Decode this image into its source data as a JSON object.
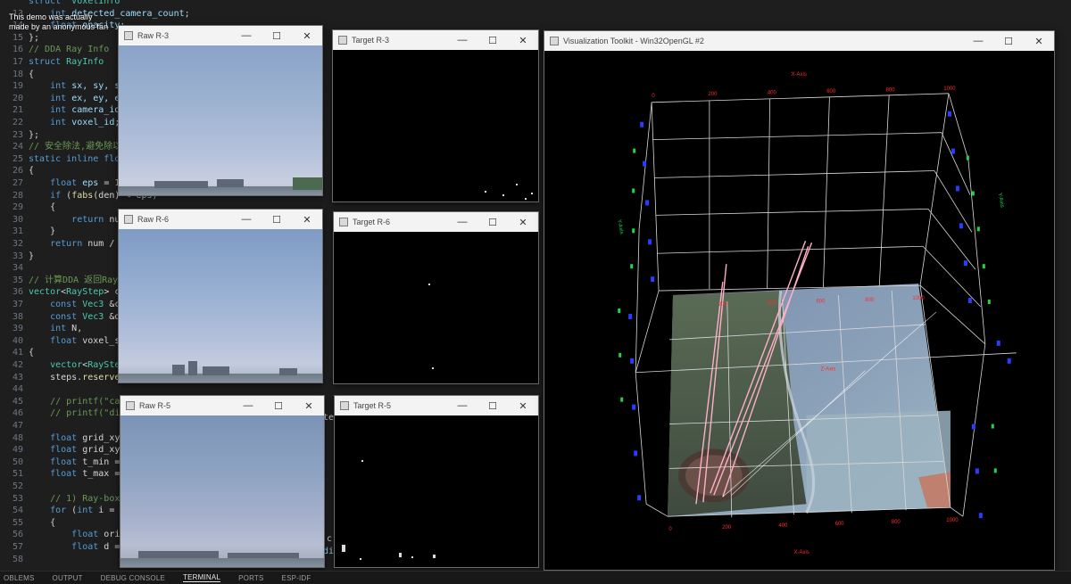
{
  "overlay": {
    "line1": "This demo was actually",
    "line2": "made by an anonymous fan"
  },
  "editor": {
    "lines": [
      {
        "num": "",
        "parts": [
          [
            "kw",
            "struct"
          ],
          [
            "",
            "  "
          ],
          [
            "ty",
            "VoxelInfo"
          ]
        ]
      },
      {
        "num": "13",
        "parts": [
          [
            "",
            "    "
          ],
          [
            "kw",
            "int"
          ],
          [
            "",
            " "
          ],
          [
            "vr",
            "detected_camera_count"
          ],
          [
            "",
            ";"
          ]
        ]
      },
      {
        "num": "14",
        "parts": [
          [
            "",
            "    "
          ],
          [
            "kw",
            "float"
          ],
          [
            "",
            " "
          ],
          [
            "vr",
            "opacity"
          ],
          [
            "",
            ";"
          ]
        ]
      },
      {
        "num": "15",
        "parts": [
          [
            "",
            "};"
          ]
        ]
      },
      {
        "num": "16",
        "parts": [
          [
            "cm",
            "// DDA Ray Info"
          ]
        ]
      },
      {
        "num": "17",
        "parts": [
          [
            "kw",
            "struct"
          ],
          [
            "",
            " "
          ],
          [
            "ty",
            "RayInfo"
          ]
        ]
      },
      {
        "num": "18",
        "parts": [
          [
            "",
            "{"
          ]
        ]
      },
      {
        "num": "19",
        "parts": [
          [
            "",
            "    "
          ],
          [
            "kw",
            "int"
          ],
          [
            "",
            " "
          ],
          [
            "vr",
            "sx, sy, sz"
          ],
          [
            "",
            ";"
          ]
        ]
      },
      {
        "num": "20",
        "parts": [
          [
            "",
            "    "
          ],
          [
            "kw",
            "int"
          ],
          [
            "",
            " "
          ],
          [
            "vr",
            "ex, ey, ez"
          ],
          [
            "",
            ";"
          ]
        ]
      },
      {
        "num": "21",
        "parts": [
          [
            "",
            "    "
          ],
          [
            "kw",
            "int"
          ],
          [
            "",
            " "
          ],
          [
            "vr",
            "camera_id"
          ],
          [
            "",
            ";"
          ]
        ]
      },
      {
        "num": "22",
        "parts": [
          [
            "",
            "    "
          ],
          [
            "kw",
            "int"
          ],
          [
            "",
            " "
          ],
          [
            "vr",
            "voxel_id"
          ],
          [
            "",
            ";"
          ]
        ]
      },
      {
        "num": "23",
        "parts": [
          [
            "",
            "};"
          ]
        ]
      },
      {
        "num": "24",
        "parts": [
          [
            "cm",
            "// 安全除法,避免除以"
          ]
        ]
      },
      {
        "num": "25",
        "parts": [
          [
            "kw",
            "static inline float"
          ]
        ]
      },
      {
        "num": "26",
        "parts": [
          [
            "",
            "{"
          ]
        ]
      },
      {
        "num": "27",
        "parts": [
          [
            "",
            "    "
          ],
          [
            "kw",
            "float"
          ],
          [
            "",
            " "
          ],
          [
            "vr",
            "eps"
          ],
          [
            "",
            " = "
          ],
          [
            "nm",
            "1e"
          ]
        ]
      },
      {
        "num": "28",
        "parts": [
          [
            "",
            "    "
          ],
          [
            "kw",
            "if"
          ],
          [
            "",
            " ("
          ],
          [
            "fn",
            "fabs"
          ],
          [
            "",
            "(den) < eps)"
          ]
        ]
      },
      {
        "num": "29",
        "parts": [
          [
            "",
            "    {"
          ]
        ]
      },
      {
        "num": "30",
        "parts": [
          [
            "",
            "        "
          ],
          [
            "kw",
            "return"
          ],
          [
            "",
            " num"
          ]
        ]
      },
      {
        "num": "31",
        "parts": [
          [
            "",
            "    }"
          ]
        ]
      },
      {
        "num": "32",
        "parts": [
          [
            "",
            "    "
          ],
          [
            "kw",
            "return"
          ],
          [
            "",
            " num / d"
          ]
        ]
      },
      {
        "num": "33",
        "parts": [
          [
            "",
            "}"
          ]
        ]
      },
      {
        "num": "34",
        "parts": [
          [
            "",
            ""
          ]
        ]
      },
      {
        "num": "35",
        "parts": [
          [
            "cm",
            "// 计算DDA 返回Ray数"
          ]
        ]
      },
      {
        "num": "36",
        "parts": [
          [
            "ty",
            "vector"
          ],
          [
            "",
            "<"
          ],
          [
            "ty",
            "RayStep"
          ],
          [
            "",
            "> ca"
          ]
        ]
      },
      {
        "num": "37",
        "parts": [
          [
            "",
            "    "
          ],
          [
            "kw",
            "const"
          ],
          [
            "",
            " "
          ],
          [
            "ty",
            "Vec3"
          ],
          [
            "",
            " &ca"
          ]
        ]
      },
      {
        "num": "38",
        "parts": [
          [
            "",
            "    "
          ],
          [
            "kw",
            "const"
          ],
          [
            "",
            " "
          ],
          [
            "ty",
            "Vec3"
          ],
          [
            "",
            " &di"
          ]
        ]
      },
      {
        "num": "39",
        "parts": [
          [
            "",
            "    "
          ],
          [
            "kw",
            "int"
          ],
          [
            "",
            " N,"
          ]
        ]
      },
      {
        "num": "40",
        "parts": [
          [
            "",
            "    "
          ],
          [
            "kw",
            "float"
          ],
          [
            "",
            " voxel_si"
          ]
        ]
      },
      {
        "num": "41",
        "parts": [
          [
            "",
            "{"
          ]
        ]
      },
      {
        "num": "42",
        "parts": [
          [
            "",
            "    "
          ],
          [
            "ty",
            "vector"
          ],
          [
            "",
            "<"
          ],
          [
            "ty",
            "RayStep"
          ]
        ]
      },
      {
        "num": "43",
        "parts": [
          [
            "",
            "    steps."
          ],
          [
            "fn",
            "reserve"
          ],
          [
            "",
            "(64);"
          ]
        ]
      },
      {
        "num": "44",
        "parts": [
          [
            "",
            ""
          ]
        ]
      },
      {
        "num": "45",
        "parts": [
          [
            "",
            "    "
          ],
          [
            "cm",
            "// printf(\"came"
          ]
        ]
      },
      {
        "num": "46",
        "parts": [
          [
            "",
            "    "
          ],
          [
            "cm",
            "// printf(\"dir_"
          ]
        ]
      },
      {
        "num": "47",
        "parts": [
          [
            "",
            ""
          ]
        ]
      },
      {
        "num": "48",
        "parts": [
          [
            "",
            "    "
          ],
          [
            "kw",
            "float"
          ],
          [
            "",
            " grid_xyz_"
          ]
        ]
      },
      {
        "num": "49",
        "parts": [
          [
            "",
            "    "
          ],
          [
            "kw",
            "float"
          ],
          [
            "",
            " grid_xyz_"
          ]
        ]
      },
      {
        "num": "50",
        "parts": [
          [
            "",
            "    "
          ],
          [
            "kw",
            "float"
          ],
          [
            "",
            " t_min = 0"
          ]
        ]
      },
      {
        "num": "51",
        "parts": [
          [
            "",
            "    "
          ],
          [
            "kw",
            "float"
          ],
          [
            "",
            " t_max = n"
          ]
        ]
      },
      {
        "num": "52",
        "parts": [
          [
            "",
            ""
          ]
        ]
      },
      {
        "num": "53",
        "parts": [
          [
            "",
            "    "
          ],
          [
            "cm",
            "// 1) Ray-box i"
          ]
        ]
      },
      {
        "num": "54",
        "parts": [
          [
            "",
            "    "
          ],
          [
            "kw",
            "for"
          ],
          [
            "",
            " ("
          ],
          [
            "kw",
            "int"
          ],
          [
            "",
            " i = 0;"
          ]
        ]
      },
      {
        "num": "55",
        "parts": [
          [
            "",
            "    {"
          ]
        ]
      },
      {
        "num": "56",
        "parts": [
          [
            "",
            "        "
          ],
          [
            "kw",
            "float"
          ],
          [
            "",
            " origi"
          ]
        ]
      },
      {
        "num": "57",
        "parts": [
          [
            "",
            "        "
          ],
          [
            "kw",
            "float"
          ],
          [
            "",
            " d = ("
          ]
        ]
      },
      {
        "num": "58",
        "parts": [
          [
            "",
            ""
          ]
        ]
      }
    ],
    "fragments": {
      "frag_c": "c",
      "frag_di": "di",
      "frag_te": "te"
    }
  },
  "windows": {
    "raw3": {
      "title": "Raw R-3"
    },
    "raw6": {
      "title": "Raw R-6"
    },
    "raw5": {
      "title": "Raw R-5"
    },
    "target3": {
      "title": "Target R-3"
    },
    "target6": {
      "title": "Target R-6"
    },
    "target5": {
      "title": "Target R-5"
    },
    "vtk": {
      "title": "Visualization Toolkit - Win32OpenGL #2"
    }
  },
  "controls": {
    "minimize": "—",
    "maximize": "☐",
    "close": "✕"
  },
  "vtk_scene": {
    "x_axis_label_top": "X-Axis",
    "x_axis_label_bottom": "X-Axis",
    "y_axis_label_left": "Y-Axis",
    "y_axis_label_right": "Y-Axis",
    "z_axis_label": "Z-Axis",
    "top_ticks": [
      "0",
      "200",
      "400",
      "600",
      "800",
      "1000"
    ],
    "bottom_ticks": [
      "0",
      "200",
      "400",
      "600",
      "800",
      "1000"
    ],
    "mid_ticks": [
      "200",
      "400",
      "600",
      "800",
      "1000"
    ],
    "colors": {
      "axis_red": "#ff2b2b",
      "axis_green": "#23d34a",
      "axis_blue": "#2c3cff",
      "grid": "#d9d9d9",
      "ray": "#ffb0c8"
    }
  },
  "panel": {
    "tabs": [
      "OBLEMS",
      "OUTPUT",
      "DEBUG CONSOLE",
      "TERMINAL",
      "PORTS",
      "ESP-IDF"
    ],
    "active": "TERMINAL"
  }
}
